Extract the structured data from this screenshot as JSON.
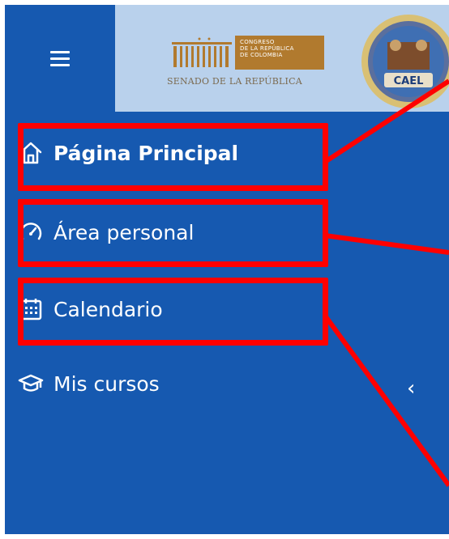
{
  "header": {
    "logo_box_text": "CONGRESO\nDE LA REPÚBLICA\nDE COLOMBIA",
    "logo_caption": "SENADO DE LA REPÚBLICA",
    "seal_text": "CAEL"
  },
  "nav": {
    "items": [
      {
        "label": "Página Principal",
        "icon": "home-icon",
        "bold": true
      },
      {
        "label": "Área personal",
        "icon": "dashboard-icon",
        "bold": false
      },
      {
        "label": "Calendario",
        "icon": "calendar-icon",
        "bold": false
      },
      {
        "label": "Mis cursos",
        "icon": "graduation-cap-icon",
        "bold": false,
        "expand": "‹"
      }
    ]
  },
  "colors": {
    "sidebar": "#1659b0",
    "header_bg": "#b9d1ec",
    "highlight": "#ff0000",
    "gold": "#b17a2e"
  }
}
